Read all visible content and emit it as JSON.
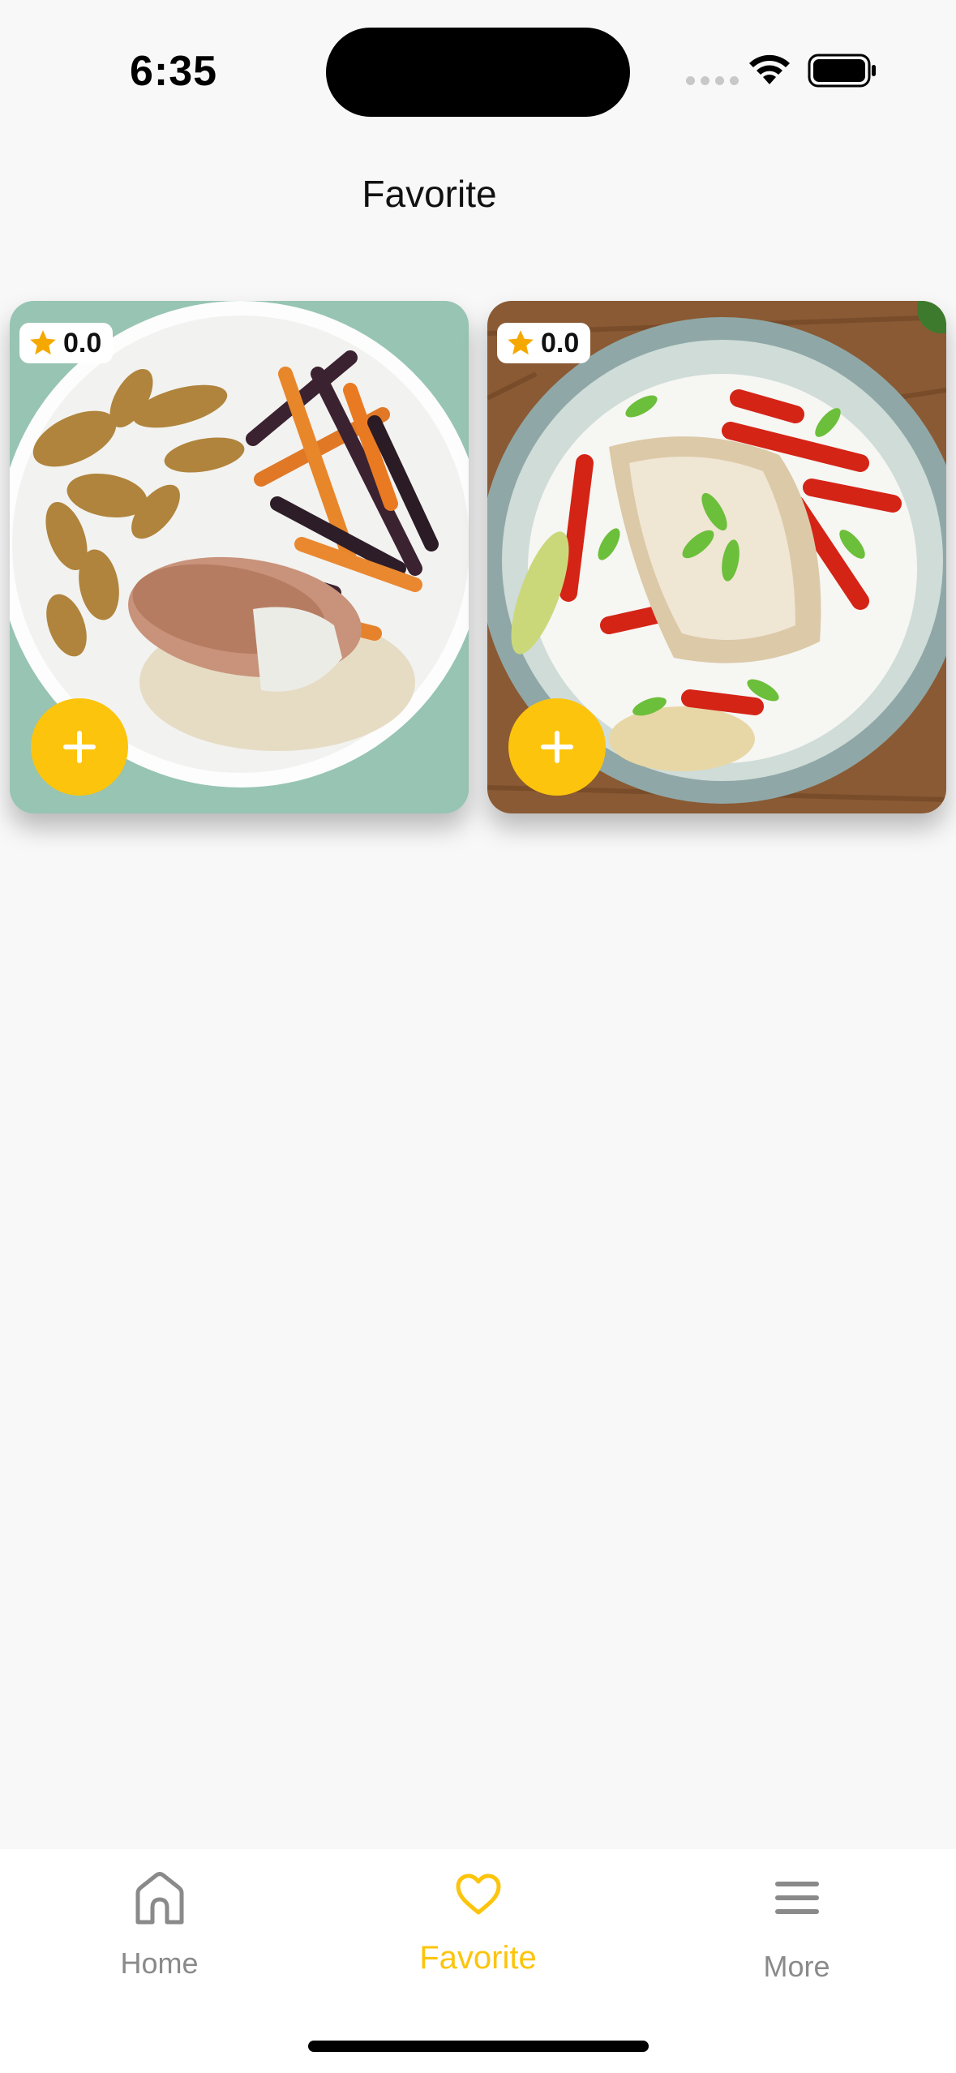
{
  "status_bar": {
    "time": "6:35"
  },
  "header": {
    "title": "Favorite"
  },
  "cards": [
    {
      "rating": "0.0",
      "add_icon": "plus-icon",
      "rating_icon": "star-icon"
    },
    {
      "rating": "0.0",
      "add_icon": "plus-icon",
      "rating_icon": "star-icon"
    }
  ],
  "tabbar": {
    "items": [
      {
        "label": "Home",
        "icon": "home-icon",
        "active": false
      },
      {
        "label": "Favorite",
        "icon": "heart-icon",
        "active": true
      },
      {
        "label": "More",
        "icon": "menu-icon",
        "active": false
      }
    ]
  },
  "colors": {
    "accent": "#fcc40c",
    "inactive": "#8a8a8a",
    "star": "#f5a800"
  }
}
